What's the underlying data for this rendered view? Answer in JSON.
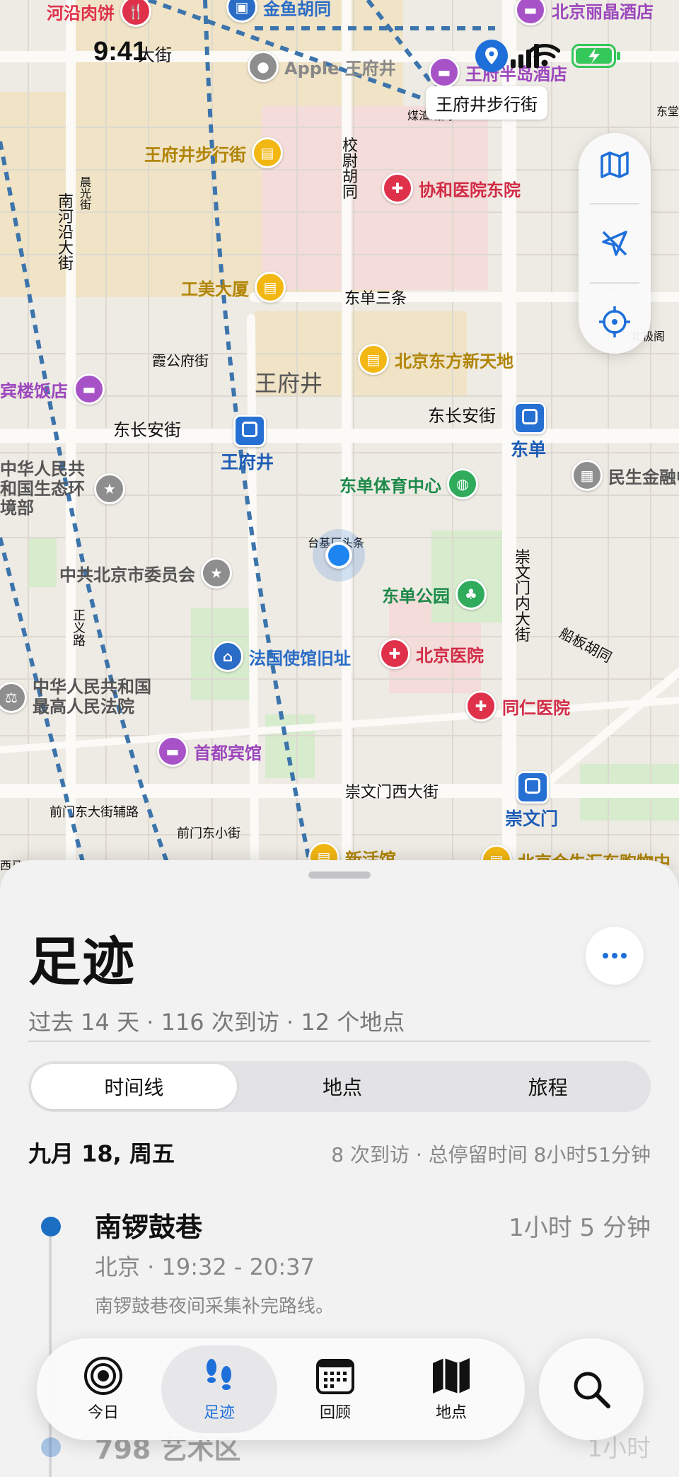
{
  "status_bar": {
    "time": "9:41"
  },
  "map": {
    "streets": [
      {
        "id": "st1",
        "label": "大街"
      },
      {
        "id": "st2",
        "label": "东长安街"
      },
      {
        "id": "st3",
        "label": "东长安街"
      },
      {
        "id": "st4",
        "label": "霞公府街"
      },
      {
        "id": "st5",
        "label": "东单三条"
      },
      {
        "id": "st6",
        "label": "校尉胡同"
      },
      {
        "id": "st7",
        "label": "南河沿大街"
      },
      {
        "id": "st8",
        "label": "崇文门西大街"
      },
      {
        "id": "st9",
        "label": "崇文门内大街"
      },
      {
        "id": "st10",
        "label": "前门东大街辅路"
      },
      {
        "id": "st11",
        "label": "前门东小街"
      },
      {
        "id": "st12",
        "label": "正义路"
      },
      {
        "id": "st13",
        "label": "船板胡同"
      },
      {
        "id": "st14",
        "label": "台基厂头条"
      },
      {
        "id": "st15",
        "label": "王府井"
      },
      {
        "id": "st16",
        "label": "煤渣胡同"
      },
      {
        "id": "st17",
        "label": "晨光街"
      },
      {
        "id": "st18",
        "label": "东堂"
      },
      {
        "id": "st19",
        "label": "北极阁"
      },
      {
        "id": "st20",
        "label": "西马"
      }
    ],
    "pois": [
      {
        "id": "p1",
        "label": "河沿肉饼",
        "pin": "red"
      },
      {
        "id": "p2",
        "label": "金鱼胡同",
        "pin": "blue"
      },
      {
        "id": "p3",
        "label": "北京丽晶酒店",
        "pin": "purple"
      },
      {
        "id": "p4",
        "label": "Apple 王府井",
        "pin": "gray"
      },
      {
        "id": "p5",
        "label": "王府半岛酒店",
        "pin": "purple"
      },
      {
        "id": "p6",
        "label": "王府井步行街",
        "pin": "gold"
      },
      {
        "id": "p7",
        "label": "协和医院东院",
        "pin": "red"
      },
      {
        "id": "p8",
        "label": "工美大厦",
        "pin": "gold"
      },
      {
        "id": "p9",
        "label": "北京东方新天地",
        "pin": "gold"
      },
      {
        "id": "p10",
        "label": "宾楼饭店",
        "pin": "purple"
      },
      {
        "id": "p11",
        "label": "东单体育中心",
        "pin": "green"
      },
      {
        "id": "p12",
        "label": "民生金融中",
        "pin": "gray"
      },
      {
        "id": "p13",
        "label": "中华人民共和国生态环境部",
        "pin": "gray"
      },
      {
        "id": "p14",
        "label": "中共北京市委员会",
        "pin": "gray"
      },
      {
        "id": "p15",
        "label": "东单公园",
        "pin": "green"
      },
      {
        "id": "p16",
        "label": "法国使馆旧址",
        "pin": "blue"
      },
      {
        "id": "p17",
        "label": "北京医院",
        "pin": "red"
      },
      {
        "id": "p18",
        "label": "同仁医院",
        "pin": "red"
      },
      {
        "id": "p19",
        "label": "中华人民共和国最高人民法院",
        "pin": "gray"
      },
      {
        "id": "p20",
        "label": "首都宾馆",
        "pin": "purple"
      },
      {
        "id": "p21",
        "label": "新活馆",
        "pin": "gold"
      },
      {
        "id": "p22",
        "label": "北京合生汇东购物中",
        "pin": "gold"
      }
    ],
    "metro": [
      {
        "id": "m1",
        "label": "王府井"
      },
      {
        "id": "m2",
        "label": "东单"
      },
      {
        "id": "m3",
        "label": "崇文门"
      }
    ],
    "callout": "王府井步行街",
    "controls": [
      {
        "id": "c1",
        "icon": "map-icon"
      },
      {
        "id": "c2",
        "icon": "location-arrow-icon"
      },
      {
        "id": "c3",
        "icon": "crosshair-icon"
      }
    ]
  },
  "sheet": {
    "title": "足迹",
    "subtitle": "过去 14 天 · 116 次到访 · 12 个地点",
    "segments": [
      {
        "label": "时间线",
        "active": true
      },
      {
        "label": "地点",
        "active": false
      },
      {
        "label": "旅程",
        "active": false
      }
    ],
    "day": {
      "title": "九月 18, 周五",
      "summary": "8 次到访 · 总停留时间 8小时51分钟"
    },
    "visits": [
      {
        "name": "南锣鼓巷",
        "duration": "1小时 5 分钟",
        "meta": "北京 · 19:32 - 20:37",
        "note": "南锣鼓巷夜间采集补完路线。"
      },
      {
        "name": "798 艺术区",
        "duration": "1小时",
        "meta": "",
        "note": ""
      }
    ]
  },
  "tabbar": {
    "tabs": [
      {
        "label": "今日",
        "icon": "target-icon",
        "active": false
      },
      {
        "label": "足迹",
        "icon": "footprints-icon",
        "active": true
      },
      {
        "label": "回顾",
        "icon": "calendar-icon",
        "active": false
      },
      {
        "label": "地点",
        "icon": "map-icon",
        "active": false
      }
    ],
    "search_icon": "search-icon"
  },
  "colors": {
    "accent": "#1e6fd9",
    "visit_dot": "#1c6ec2",
    "metro": "#2770d3"
  }
}
